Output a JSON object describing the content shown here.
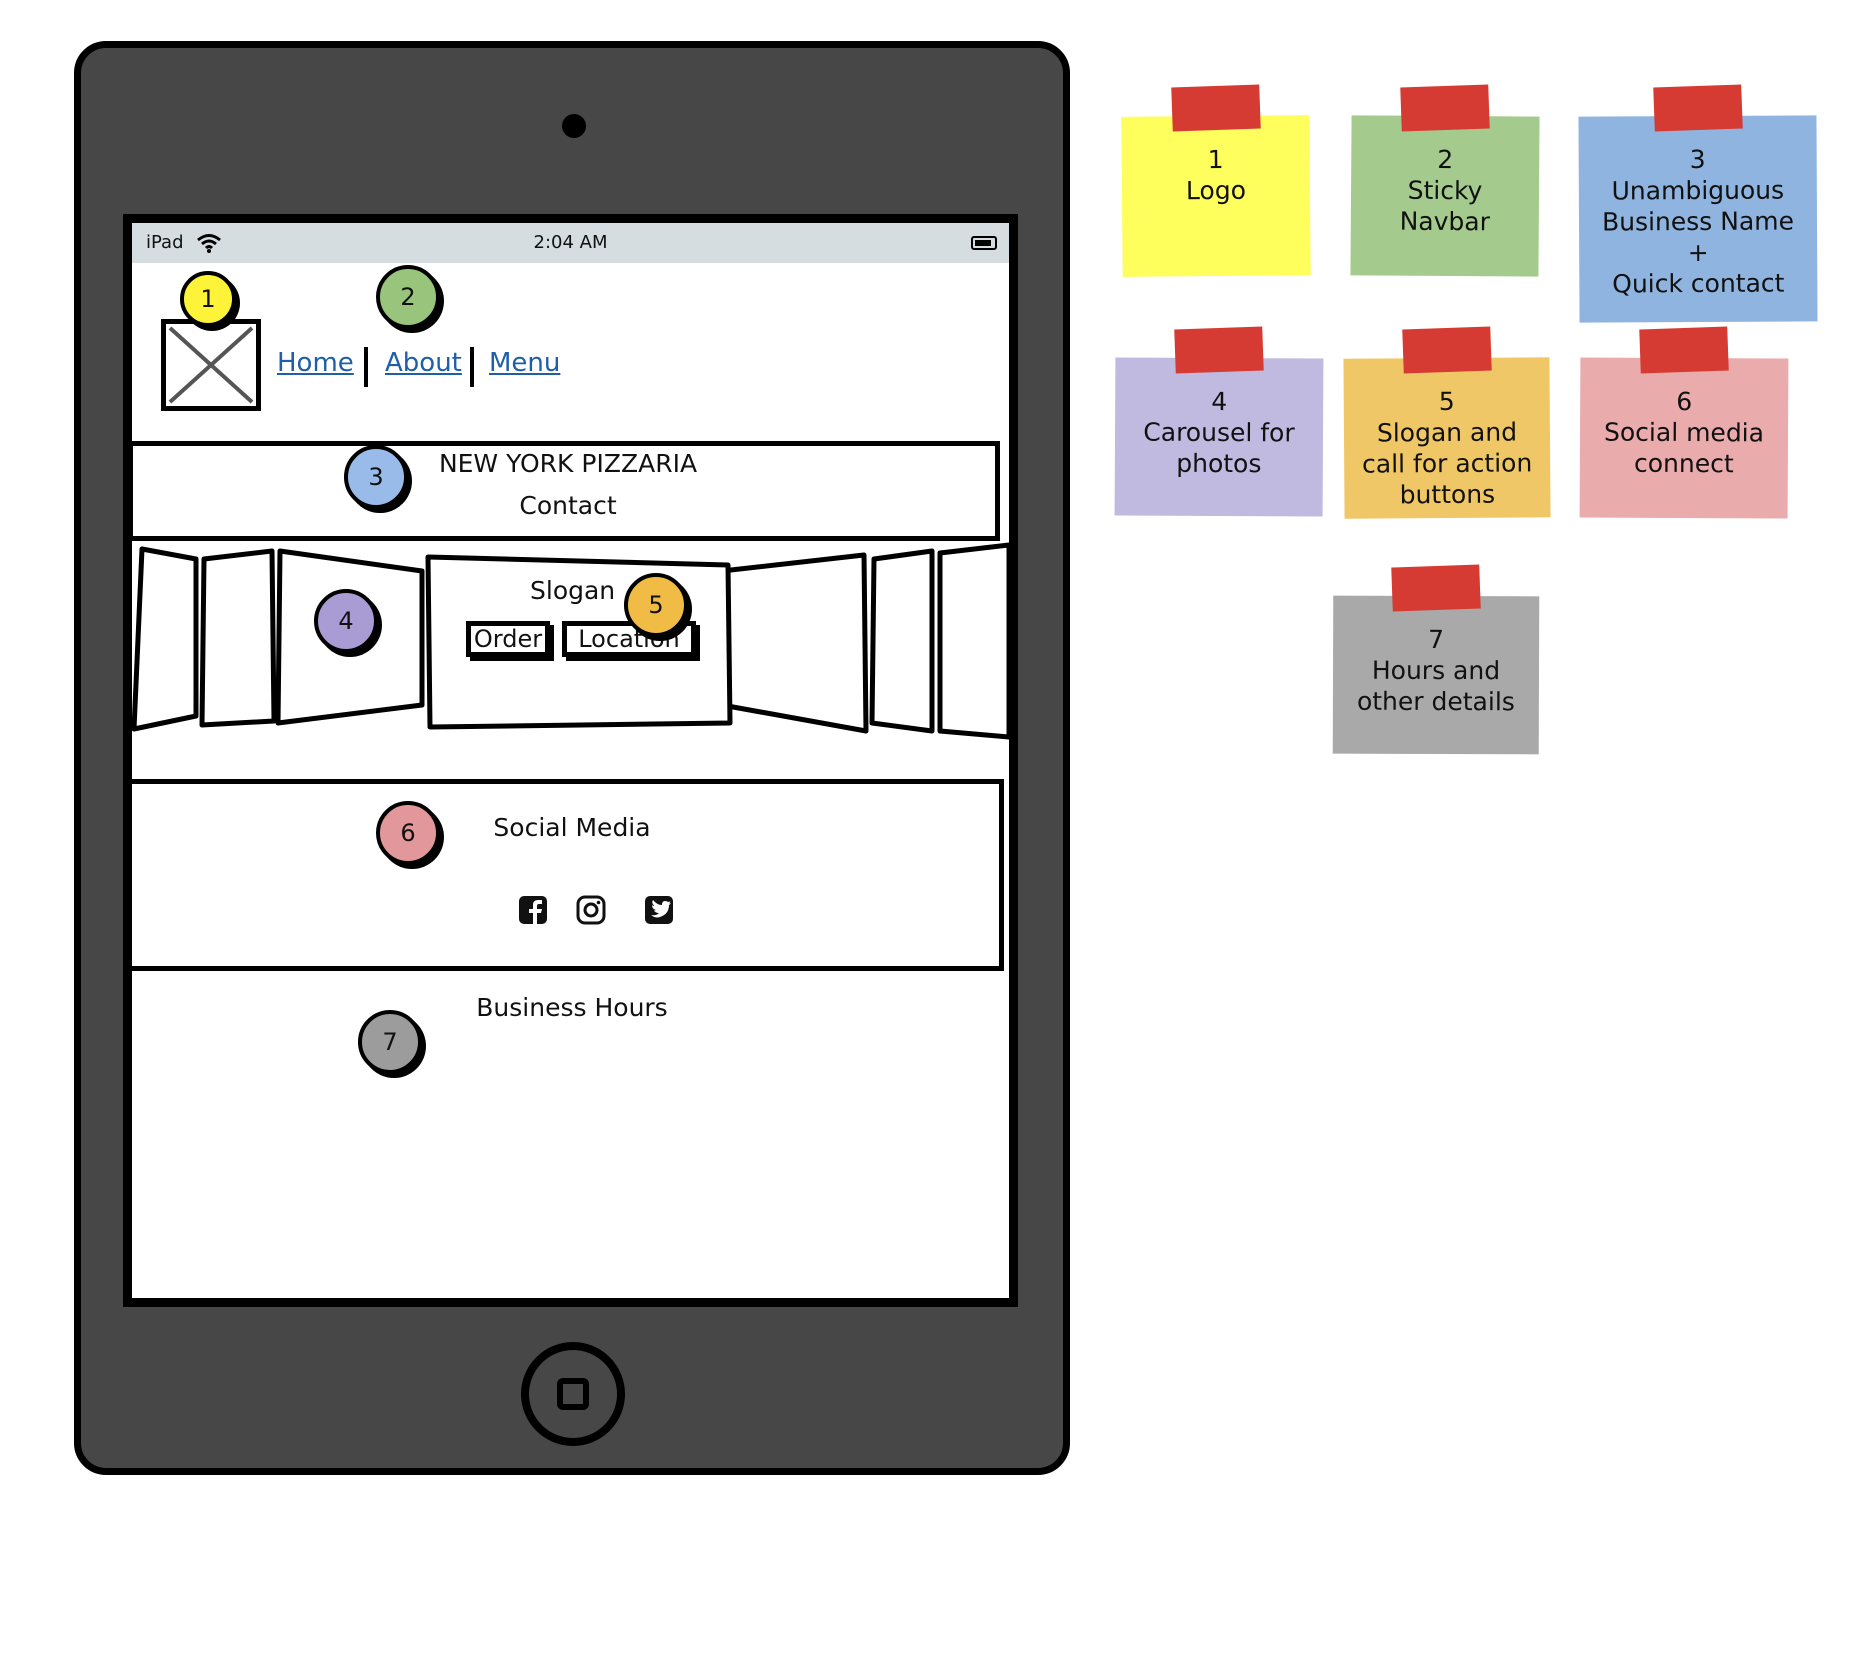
{
  "device": {
    "carrier": "iPad",
    "time": "2:04 AM"
  },
  "nav": {
    "home": "Home",
    "about": "About",
    "menu": "Menu"
  },
  "business": {
    "name": "NEW YORK PIZZARIA",
    "contact": "Contact"
  },
  "hero": {
    "slogan": "Slogan",
    "order_button": "Order",
    "location_button": "Location"
  },
  "social": {
    "title": "Social Media",
    "icons": [
      "facebook-icon",
      "instagram-icon",
      "twitter-icon"
    ]
  },
  "hours": {
    "title": "Business Hours"
  },
  "badges": [
    "1",
    "2",
    "3",
    "4",
    "5",
    "6",
    "7"
  ],
  "notes": [
    {
      "num": "1",
      "lines": [
        "Logo"
      ],
      "color": "#fefe5c"
    },
    {
      "num": "2",
      "lines": [
        "Sticky",
        "Navbar"
      ],
      "color": "#a4cb8d"
    },
    {
      "num": "3",
      "lines": [
        "Unambiguous",
        "Business Name",
        "+",
        "Quick contact"
      ],
      "color": "#8fb4df"
    },
    {
      "num": "4",
      "lines": [
        "Carousel for",
        "photos"
      ],
      "color": "#c0b9e0"
    },
    {
      "num": "5",
      "lines": [
        "Slogan and",
        "call for action",
        "buttons"
      ],
      "color": "#f0c766"
    },
    {
      "num": "6",
      "lines": [
        "Social media",
        "connect"
      ],
      "color": "#e9abab"
    },
    {
      "num": "7",
      "lines": [
        "Hours and",
        "other details"
      ],
      "color": "#a9a9a9"
    }
  ],
  "colors": {
    "frame": "#474747",
    "statusbar": "#d6dde1",
    "link": "#1f5fa8",
    "badge_1": "#fdf43a",
    "badge_2": "#98c47c",
    "badge_3": "#98bbe9",
    "badge_4": "#a99bd4",
    "badge_5": "#f0bc45",
    "badge_6": "#e2989a",
    "badge_7": "#9c9c9c",
    "tape": "#d53b33"
  }
}
